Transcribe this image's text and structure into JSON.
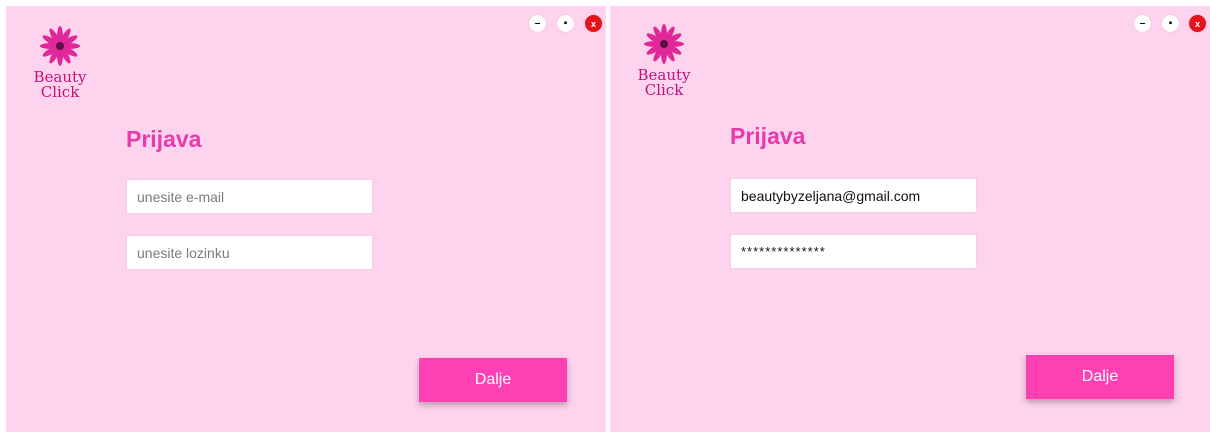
{
  "screens": [
    {
      "logo": {
        "line1": "Beauty",
        "line2": "Click"
      },
      "title": "Prijava",
      "email": {
        "value": "",
        "placeholder": "unesite e-mail"
      },
      "password": {
        "value": "",
        "placeholder": "unesite lozinku"
      },
      "next_label": "Dalje",
      "window_buttons": {
        "minimize": "–",
        "restore": "▪",
        "close": "x"
      }
    },
    {
      "logo": {
        "line1": "Beauty",
        "line2": "Click"
      },
      "title": "Prijava",
      "email": {
        "value": "beautybyzeljana@gmail.com",
        "placeholder": ""
      },
      "password": {
        "value": "**************",
        "placeholder": ""
      },
      "next_label": "Dalje",
      "window_buttons": {
        "minimize": "–",
        "restore": "▪",
        "close": "x"
      }
    }
  ],
  "colors": {
    "background": "#fdd3ee",
    "title": "#e83aab",
    "button": "#ff3fb4",
    "logo_text": "#c2137a",
    "close_button": "#e4131c"
  },
  "icons": {
    "logo": "pink-flower-icon"
  }
}
